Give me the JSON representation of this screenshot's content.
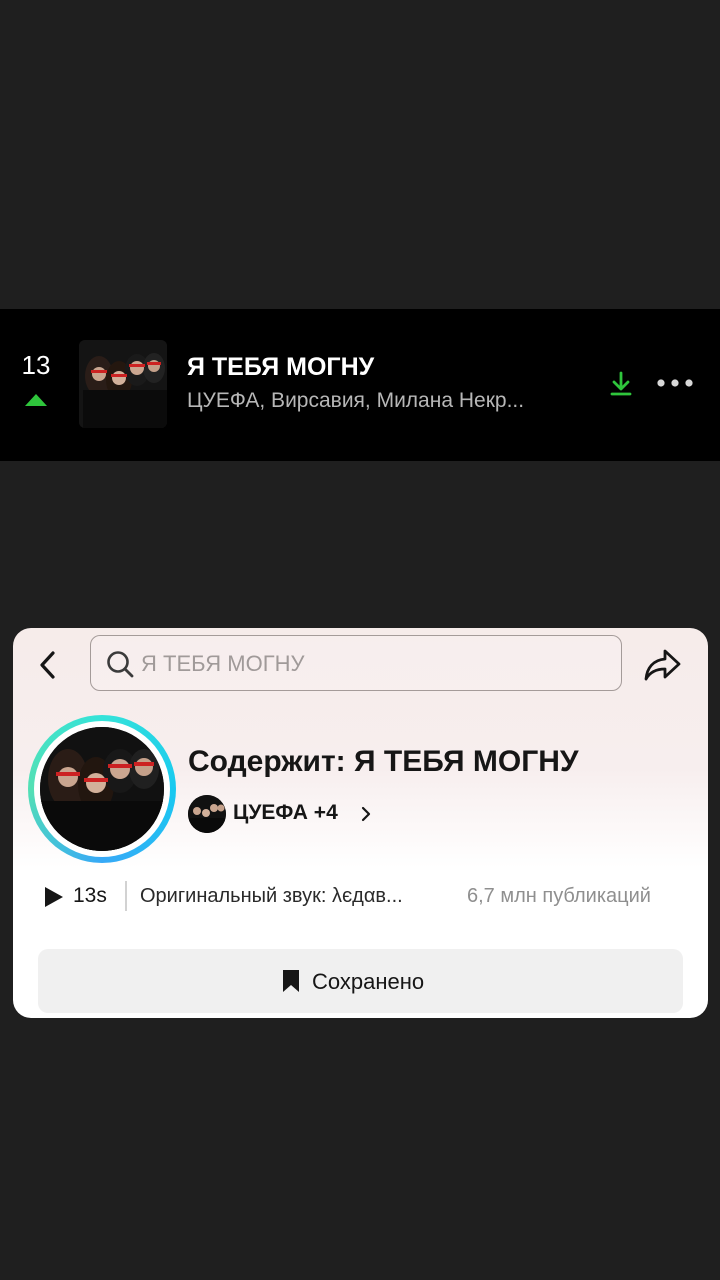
{
  "chart_entry": {
    "rank": "13",
    "rank_change": "up",
    "title": "Я ТЕБЯ МОГНУ",
    "artists": "ЦУЕФА, Вирсавия, Милана Некр...",
    "icons": {
      "rank_arrow": "arrow-up-icon",
      "download": "download-icon",
      "more": "more-dots-icon"
    },
    "colors": {
      "accent": "#2fc53c"
    }
  },
  "sound_card": {
    "search": {
      "value": "Я ТЕБЯ МОГНУ"
    },
    "title": "Содержит: Я ТЕБЯ МОГНУ",
    "artist_link": "ЦУЕФА +4",
    "duration": "13s",
    "sound_name": "Оригинальный звук: λєдαв...",
    "publications": "6,7 млн публикаций",
    "saved_label": "Сохранено",
    "icons": {
      "back": "chevron-left-icon",
      "search": "search-icon",
      "share": "share-icon",
      "play": "play-icon",
      "bookmark": "bookmark-icon"
    }
  }
}
